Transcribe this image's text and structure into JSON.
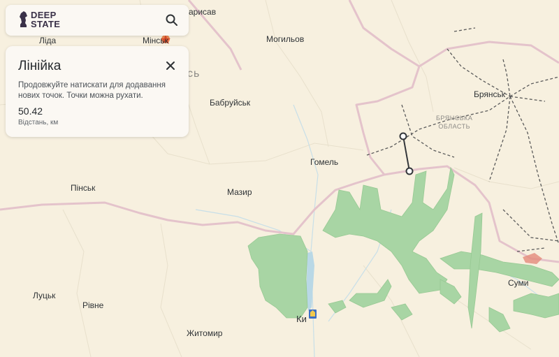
{
  "app": {
    "logo_line1": "DEEP",
    "logo_line2": "STATE"
  },
  "search": {
    "icon": "search-icon"
  },
  "ruler": {
    "title": "Лінійка",
    "hint": "Продовжуйте натискати для додавання нових точок. Точки можна рухати.",
    "distance": "50.42",
    "distance_label": "Відстань, км",
    "close_icon": "close-icon"
  },
  "map": {
    "cities": {
      "barysaw": "арисав",
      "lida": "Ліда",
      "minsk": "Мінськ",
      "mogilev": "Могильов",
      "babruisk": "Бабруйськ",
      "bryansk": "Брянськ",
      "gomel": "Гомель",
      "pinsk": "Пінськ",
      "mazyr": "Мазир",
      "lutsk": "Луцьк",
      "rivne": "Рівне",
      "zhytomyr": "Житомир",
      "kyiv": "Ки",
      "sumy": "Суми"
    },
    "regions": {
      "bryansk_line1": "БРЯНСЬКА",
      "bryansk_line2": "ОБЛАСТЬ",
      "belarus_fragment": "сь"
    },
    "colors": {
      "land": "#f7f0df",
      "occupied_green": "#a8d5a4",
      "border_pink": "#e4c3cb",
      "water": "#b9d8e6",
      "ruler_line": "#33363a"
    }
  }
}
